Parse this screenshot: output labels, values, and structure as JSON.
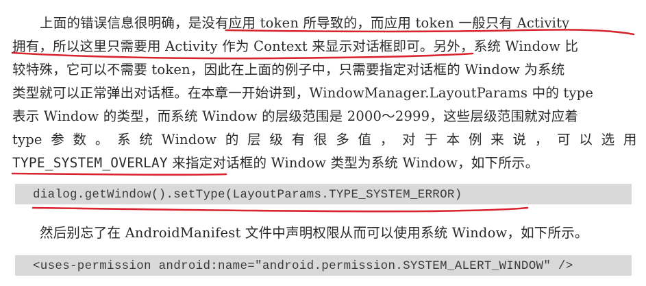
{
  "paragraph1": {
    "lines": [
      "上面的错误信息很明确，是没有应用 token 所导致的，而应用 token 一般只有 Activity",
      "拥有，所以这里只需要用 Activity 作为 Context 来显示对话框即可。另外，系统 Window 比",
      "较特殊，它可以不需要 token，因此在上面的例子中，只需要指定对话框的 Window 为系统",
      "类型就可以正常弹出对话框。在本章一开始讲到，WindowManager.LayoutParams 中的 type",
      "表示 Window 的类型，而系统 Window 的层级范围是 2000～2999，这些层级范围就对应着"
    ],
    "spread_line": [
      "type",
      "参",
      "数",
      "。",
      "系",
      "统",
      "Window",
      "的",
      "层",
      "级",
      "有",
      "很",
      "多",
      "值",
      "，",
      "对",
      "于",
      "本",
      "例",
      "来",
      "说",
      "，",
      "可",
      "以",
      "选",
      "用"
    ],
    "last_line_code": "TYPE_SYSTEM_OVERLAY",
    "last_line_rest": "来指定对话框的 Window 类型为系统 Window，如下所示。"
  },
  "code1": "dialog.getWindow().setType(LayoutParams.TYPE_SYSTEM_ERROR)",
  "paragraph2": "然后别忘了在 AndroidManifest 文件中声明权限从而可以使用系统 Window，如下所示。",
  "code2": "<uses-permission android:name=\"android.permission.SYSTEM_ALERT_WINDOW\" />",
  "colors": {
    "annotation_red": "#d8242f",
    "code_background": "#d9d9d9",
    "text": "#2a2a2a"
  }
}
